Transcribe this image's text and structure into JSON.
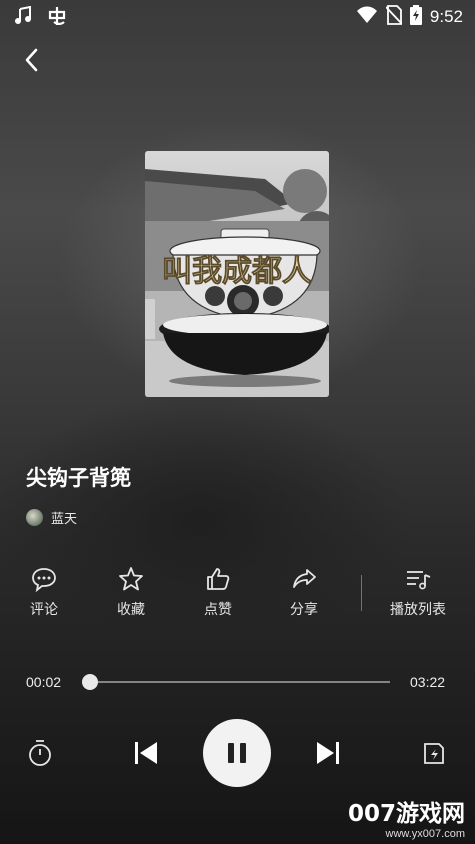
{
  "status_bar": {
    "time": "9:52"
  },
  "song": {
    "title": "尖钩子背篼",
    "artist": "蓝天"
  },
  "cover": {
    "overlay_text": "叫我成都人"
  },
  "actions": [
    {
      "label": "评论",
      "icon": "comment-icon"
    },
    {
      "label": "收藏",
      "icon": "star-icon"
    },
    {
      "label": "点赞",
      "icon": "thumbs-up-icon"
    },
    {
      "label": "分享",
      "icon": "share-icon"
    },
    {
      "label": "播放列表",
      "icon": "playlist-icon"
    }
  ],
  "progress": {
    "current": "00:02",
    "total": "03:22",
    "fraction": 0.01
  },
  "watermark": {
    "brand": "007游戏网",
    "url": "www.yx007.com"
  }
}
